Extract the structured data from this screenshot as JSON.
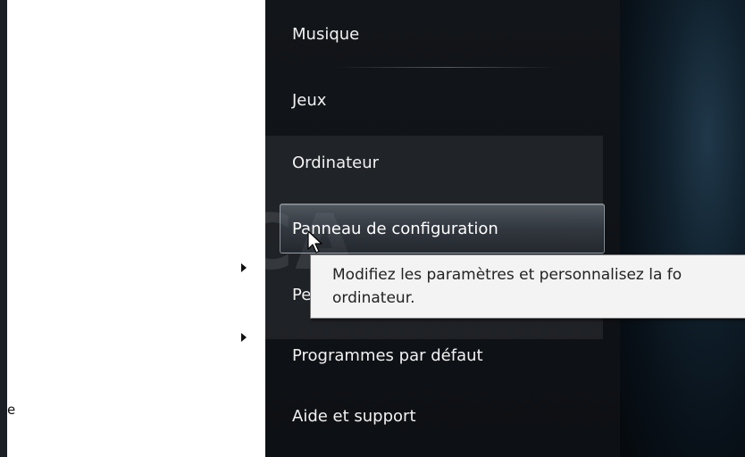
{
  "start_menu": {
    "right_items": [
      {
        "label": "Musique"
      },
      {
        "label": "Jeux"
      },
      {
        "label": "Ordinateur"
      },
      {
        "label": "Panneau de configuration",
        "state": "hovered"
      },
      {
        "label": "Pe"
      },
      {
        "label": "Programmes par défaut"
      },
      {
        "label": "Aide et support"
      }
    ],
    "left_pane": {
      "cut_text": "e"
    }
  },
  "tooltip": {
    "line1": "Modifiez les paramètres et personnalisez la fo",
    "line2": "ordinateur."
  },
  "watermark": {
    "text": "PCA"
  },
  "colors": {
    "menu_bg": "#121519",
    "menu_text": "#f2f2f2",
    "left_pane_bg": "#ffffff",
    "tooltip_bg": "#f3f3f3"
  }
}
